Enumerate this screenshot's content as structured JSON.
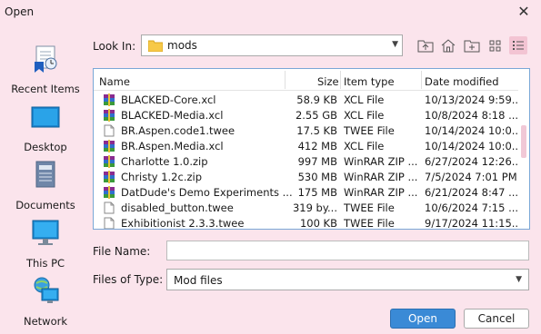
{
  "window": {
    "title": "Open"
  },
  "places": [
    {
      "label": "Recent Items",
      "icon": "recent-items-icon"
    },
    {
      "label": "Desktop",
      "icon": "desktop-icon"
    },
    {
      "label": "Documents",
      "icon": "documents-icon"
    },
    {
      "label": "This PC",
      "icon": "computer-icon"
    },
    {
      "label": "Network",
      "icon": "network-icon"
    }
  ],
  "look_in": {
    "label": "Look In:",
    "value": "mods"
  },
  "toolbar": {
    "icons": [
      "up-folder-icon",
      "home-icon",
      "new-folder-icon",
      "list-view-icon",
      "details-view-icon"
    ]
  },
  "columns": {
    "name": "Name",
    "size": "Size",
    "type": "Item type",
    "date": "Date modified"
  },
  "files": [
    {
      "name": "BLACKED-Core.xcl",
      "size": "58.9 KB",
      "type": "XCL File",
      "date": "10/13/2024 9:59...",
      "icon": "winrar-icon"
    },
    {
      "name": "BLACKED-Media.xcl",
      "size": "2.55 GB",
      "type": "XCL File",
      "date": "10/8/2024 8:18 ...",
      "icon": "winrar-icon"
    },
    {
      "name": "BR.Aspen.code1.twee",
      "size": "17.5 KB",
      "type": "TWEE File",
      "date": "10/14/2024 10:0...",
      "icon": "document-icon"
    },
    {
      "name": "BR.Aspen.Media.xcl",
      "size": "412 MB",
      "type": "XCL File",
      "date": "10/14/2024 10:0...",
      "icon": "winrar-icon"
    },
    {
      "name": "Charlotte 1.0.zip",
      "size": "997 MB",
      "type": "WinRAR ZIP ...",
      "date": "6/27/2024 12:26...",
      "icon": "winrar-icon"
    },
    {
      "name": "Christy 1.2c.zip",
      "size": "530 MB",
      "type": "WinRAR ZIP ...",
      "date": "7/5/2024 7:01 PM",
      "icon": "winrar-icon"
    },
    {
      "name": "DatDude's Demo Experiments ...",
      "size": "175 MB",
      "type": "WinRAR ZIP ...",
      "date": "6/21/2024 8:47 ...",
      "icon": "winrar-icon"
    },
    {
      "name": "disabled_button.twee",
      "size": "319 by...",
      "type": "TWEE File",
      "date": "10/6/2024 7:15 ...",
      "icon": "document-icon"
    },
    {
      "name": "Exhibitionist 2.3.3.twee",
      "size": "100 KB",
      "type": "TWEE File",
      "date": "9/17/2024 11:15...",
      "icon": "document-icon"
    }
  ],
  "file_name": {
    "label": "File Name:",
    "value": ""
  },
  "files_of_type": {
    "label": "Files of Type:",
    "value": "Mod files"
  },
  "buttons": {
    "open": "Open",
    "cancel": "Cancel"
  },
  "colors": {
    "background": "#fbe4ec",
    "accent": "#3a8ad6",
    "selection_border": "#7aa7d6"
  }
}
